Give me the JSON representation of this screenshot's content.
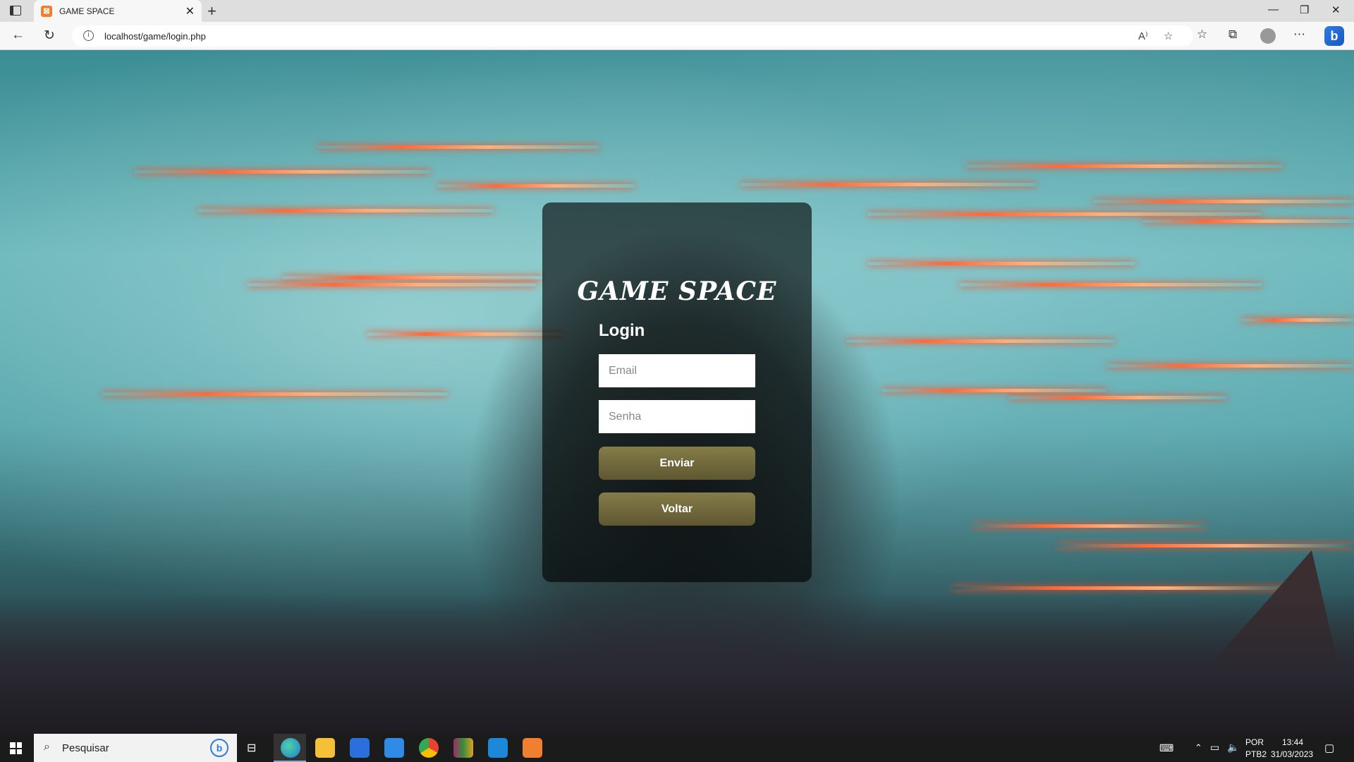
{
  "browser": {
    "tab_title": "GAME SPACE",
    "favicon_letter": "⊠",
    "url": "localhost/game/login.php",
    "read_aloud_label": "A⁾"
  },
  "page": {
    "brand": "GAME SPACE",
    "login_heading": "Login",
    "email_placeholder": "Email",
    "password_placeholder": "Senha",
    "submit_label": "Enviar",
    "back_label": "Voltar",
    "button_color": "#7a7040"
  },
  "taskbar": {
    "search_placeholder": "Pesquisar",
    "language_top": "POR",
    "language_bottom": "PTB2",
    "time": "13:44",
    "date": "31/03/2023"
  }
}
